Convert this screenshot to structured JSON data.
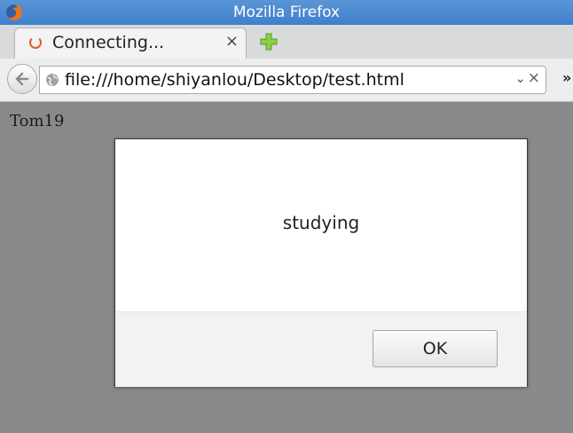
{
  "window": {
    "title": "Mozilla Firefox",
    "app_icon": "firefox-icon"
  },
  "tabs": [
    {
      "title": "Connecting...",
      "icon": "loading-spinner-icon",
      "close_glyph": "×"
    }
  ],
  "new_tab": {
    "icon": "plus-icon"
  },
  "nav": {
    "back_icon": "back-arrow-icon",
    "url": "file:///home/shiyanlou/Desktop/test.html",
    "site_icon": "globe-icon",
    "dropdown_glyph": "⌄",
    "clear_glyph": "×",
    "overflow_glyph": "»"
  },
  "page": {
    "text": "Tom19"
  },
  "dialog": {
    "message": "studying",
    "ok_label": "OK"
  },
  "colors": {
    "titlebar": "#4a89d2",
    "content_overlay": "#8a8a8a",
    "spinner": "#e05a2a",
    "plus": "#7cc13a"
  }
}
